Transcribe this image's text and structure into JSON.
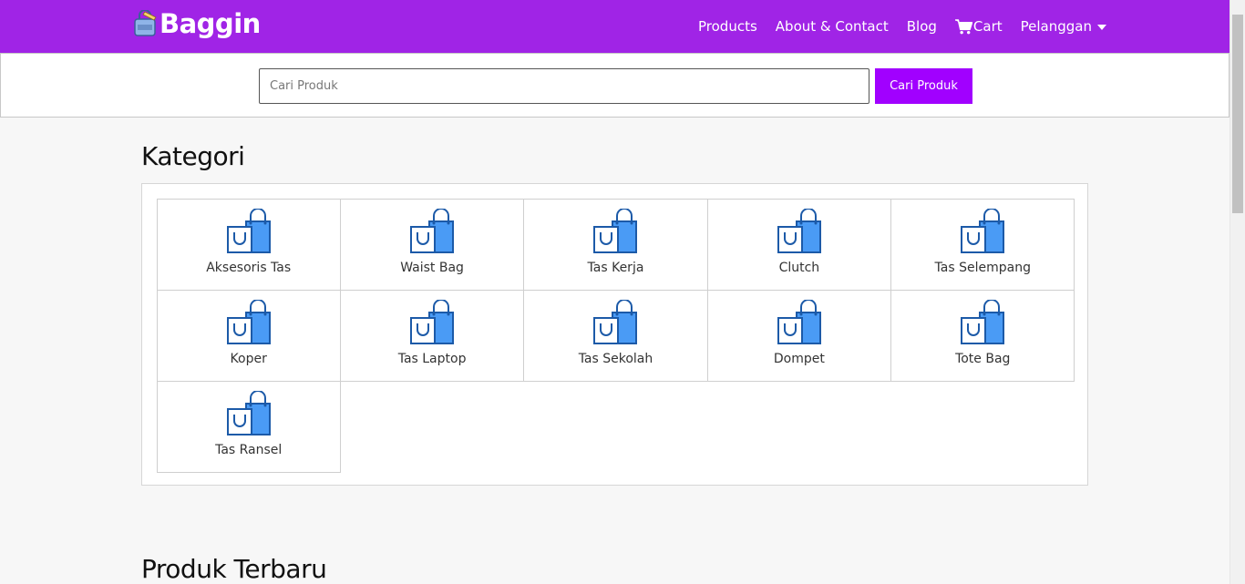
{
  "navbar": {
    "brand": "Baggin",
    "links": [
      {
        "label": "Products"
      },
      {
        "label": "About & Contact"
      },
      {
        "label": "Blog"
      },
      {
        "label": "Cart",
        "icon": "cart-icon"
      },
      {
        "label": "Pelanggan",
        "icon": "caret-down-icon"
      }
    ]
  },
  "search": {
    "placeholder": "Cari Produk",
    "button_label": "Cari Produk"
  },
  "sections": {
    "kategori_title": "Kategori",
    "produk_title": "Produk Terbaru"
  },
  "categories": [
    {
      "label": "Aksesoris Tas",
      "icon": "shopping-bag-icon"
    },
    {
      "label": "Waist Bag",
      "icon": "shopping-bag-icon"
    },
    {
      "label": "Tas Kerja",
      "icon": "shopping-bag-icon"
    },
    {
      "label": "Clutch",
      "icon": "shopping-bag-icon"
    },
    {
      "label": "Tas Selempang",
      "icon": "shopping-bag-icon"
    },
    {
      "label": "Koper",
      "icon": "shopping-bag-icon"
    },
    {
      "label": "Tas Laptop",
      "icon": "shopping-bag-icon"
    },
    {
      "label": "Tas Sekolah",
      "icon": "shopping-bag-icon"
    },
    {
      "label": "Dompet",
      "icon": "shopping-bag-icon"
    },
    {
      "label": "Tote Bag",
      "icon": "shopping-bag-icon"
    },
    {
      "label": "Tas Ransel",
      "icon": "shopping-bag-icon"
    }
  ],
  "colors": {
    "navbar": "#a024e6",
    "button": "#a100ff",
    "icon_blue": "#4a9bf5",
    "icon_outline": "#1c5aa8"
  }
}
